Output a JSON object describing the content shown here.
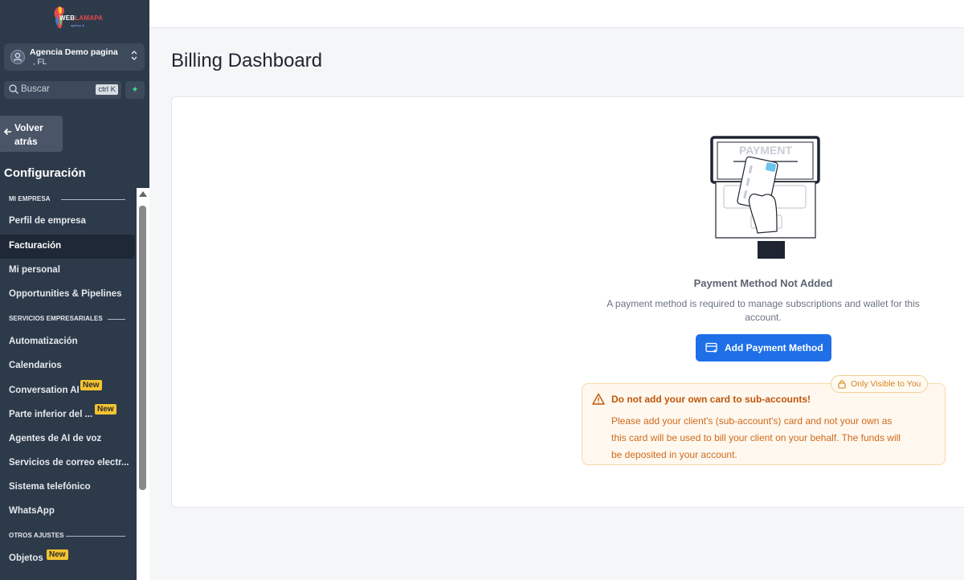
{
  "brand": {
    "logo_part1": "WEB",
    "logo_part2": "LAMAPA",
    "logo_sub": "agency ai",
    "accent": "#1f6fe8"
  },
  "account": {
    "name": "Agencia Demo pagina",
    "location": ", FL"
  },
  "search": {
    "placeholder": "Buscar",
    "shortcut": "ctrl K"
  },
  "back": {
    "label": "Volver atrás"
  },
  "sidebar": {
    "title": "Configuración",
    "sections": [
      {
        "label": "MI EMPRESA"
      },
      {
        "label": "SERVICIOS EMPRESARIALES"
      },
      {
        "label": "OTROS AJUSTES"
      }
    ],
    "items": [
      {
        "label": "Perfil de empresa"
      },
      {
        "label": "Facturación",
        "active": true
      },
      {
        "label": "Mi personal"
      },
      {
        "label": "Opportunities & Pipelines"
      },
      {
        "label": "Automatización"
      },
      {
        "label": "Calendarios"
      },
      {
        "label": "Conversation AI",
        "badge": "New"
      },
      {
        "label": "Parte inferior del ...",
        "badge": "New"
      },
      {
        "label": "Agentes de AI de voz"
      },
      {
        "label": "Servicios de correo electr..."
      },
      {
        "label": "Sistema telefónico"
      },
      {
        "label": "WhatsApp"
      },
      {
        "label": "Objetos",
        "badge": "New"
      }
    ]
  },
  "main": {
    "title": "Billing Dashboard",
    "illustration_label": "PAYMENT",
    "empty_title": "Payment Method Not Added",
    "empty_description": "A payment method is required to manage subscriptions and wallet for this account.",
    "add_button": "Add Payment Method",
    "visibility_pill": "Only Visible to You",
    "warning": {
      "title": "Do not add your own card to sub-accounts!",
      "text": "Please add your client's (sub-account's) card and not your own as this card will be used to bill your client on your behalf. The funds will be deposited in your account."
    }
  }
}
